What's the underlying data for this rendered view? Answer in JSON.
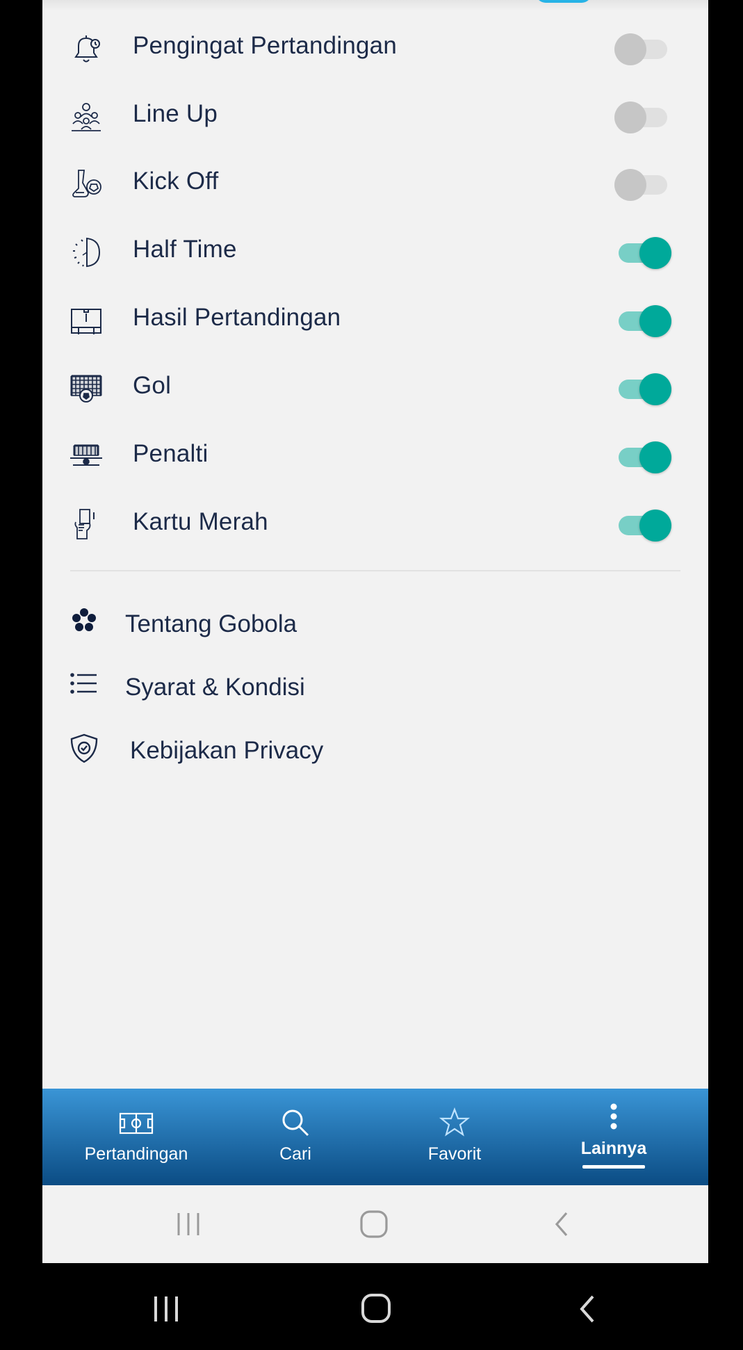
{
  "notifications": [
    {
      "label": "Pengingat Pertandingan",
      "icon": "bell-icon",
      "enabled": false
    },
    {
      "label": "Line Up",
      "icon": "team-icon",
      "enabled": false
    },
    {
      "label": "Kick Off",
      "icon": "kick-off-icon",
      "enabled": false
    },
    {
      "label": "Half Time",
      "icon": "half-time-icon",
      "enabled": true
    },
    {
      "label": "Hasil Pertandingan",
      "icon": "scoreboard-icon",
      "enabled": true
    },
    {
      "label": "Gol",
      "icon": "goal-icon",
      "enabled": true
    },
    {
      "label": "Penalti",
      "icon": "penalty-icon",
      "enabled": true
    },
    {
      "label": "Kartu Merah",
      "icon": "red-card-icon",
      "enabled": true
    }
  ],
  "links": [
    {
      "label": "Tentang Gobola",
      "icon": "gobola-logo-icon"
    },
    {
      "label": "Syarat & Kondisi",
      "icon": "list-icon"
    },
    {
      "label": "Kebijakan Privacy",
      "icon": "shield-icon"
    }
  ],
  "bottom_nav": {
    "items": [
      {
        "label": "Pertandingan",
        "icon": "pitch-icon",
        "active": false
      },
      {
        "label": "Cari",
        "icon": "search-icon",
        "active": false
      },
      {
        "label": "Favorit",
        "icon": "star-icon",
        "active": false
      },
      {
        "label": "Lainnya",
        "icon": "more-vertical-icon",
        "active": true
      }
    ]
  },
  "colors": {
    "toggle_on": "#00a99a",
    "toggle_off": "#c6c6c6",
    "nav_gradient_top": "#3a95d6",
    "nav_gradient_bottom": "#0b4c84",
    "text": "#1c2a48"
  }
}
